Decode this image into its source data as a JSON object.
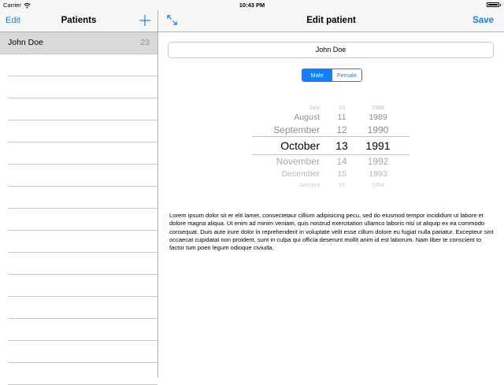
{
  "status_bar": {
    "carrier": "Carrier",
    "time": "10:43 PM"
  },
  "master": {
    "edit_label": "Edit",
    "title": "Patients",
    "rows": [
      {
        "name": "John Doe",
        "count": "23"
      }
    ]
  },
  "detail": {
    "title": "Edit patient",
    "save_label": "Save",
    "name_value": "John Doe",
    "gender": {
      "options": [
        "Male",
        "Female"
      ],
      "selected": "Male"
    },
    "date_picker": {
      "months": [
        "July",
        "August",
        "September",
        "October",
        "November",
        "December",
        "January"
      ],
      "days": [
        "10",
        "11",
        "12",
        "13",
        "14",
        "15",
        "16"
      ],
      "years": [
        "1988",
        "1989",
        "1990",
        "1991",
        "1992",
        "1993",
        "1994"
      ],
      "selected": {
        "month": "October",
        "day": "13",
        "year": "1991"
      }
    },
    "body_text": "Lorem ipsum dolor sit er elit lamet, consectetaur cillium adipisicing pecu, sed do eiusmod tempor incididunt ut labore et dolore magna aliqua. Ut enim ad minim veniam, quis nostrud exercitation ullamco laboris nisi ut aliquip ex ea commodo consequat. Duis aute irure dolor in reprehenderit in voluptate velit esse cillum dolore eu fugiat nulla pariatur. Excepteur sint occaecat cupidatat non proident, sunt in culpa qui officia deserunt mollit anim id est laborum. Nam liber te conscient to factor tum poen legum odioque civiuda."
  },
  "colors": {
    "accent": "#147efb",
    "bar_bg": "#f7f7f7",
    "selected_row": "#d9d9d9",
    "separator": "#c8c7cc"
  },
  "icons": {
    "add": "plus-icon",
    "expand": "expand-arrows-icon",
    "wifi": "wifi-icon",
    "battery": "battery-icon"
  }
}
